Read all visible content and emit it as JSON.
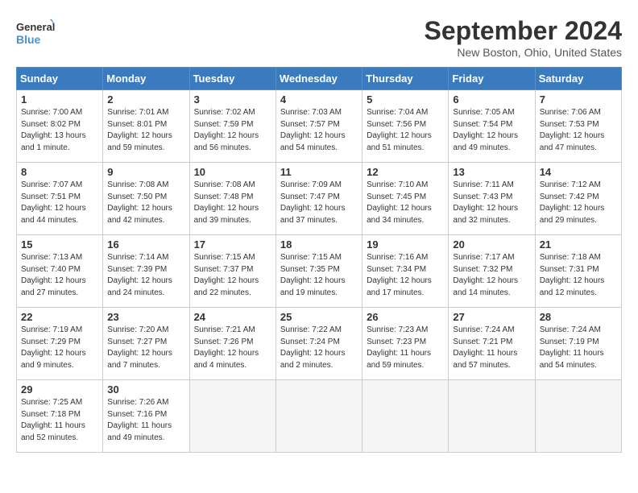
{
  "logo": {
    "line1": "General",
    "line2": "Blue"
  },
  "title": "September 2024",
  "subtitle": "New Boston, Ohio, United States",
  "weekdays": [
    "Sunday",
    "Monday",
    "Tuesday",
    "Wednesday",
    "Thursday",
    "Friday",
    "Saturday"
  ],
  "weeks": [
    [
      {
        "day": "1",
        "info": "Sunrise: 7:00 AM\nSunset: 8:02 PM\nDaylight: 13 hours\nand 1 minute."
      },
      {
        "day": "2",
        "info": "Sunrise: 7:01 AM\nSunset: 8:01 PM\nDaylight: 12 hours\nand 59 minutes."
      },
      {
        "day": "3",
        "info": "Sunrise: 7:02 AM\nSunset: 7:59 PM\nDaylight: 12 hours\nand 56 minutes."
      },
      {
        "day": "4",
        "info": "Sunrise: 7:03 AM\nSunset: 7:57 PM\nDaylight: 12 hours\nand 54 minutes."
      },
      {
        "day": "5",
        "info": "Sunrise: 7:04 AM\nSunset: 7:56 PM\nDaylight: 12 hours\nand 51 minutes."
      },
      {
        "day": "6",
        "info": "Sunrise: 7:05 AM\nSunset: 7:54 PM\nDaylight: 12 hours\nand 49 minutes."
      },
      {
        "day": "7",
        "info": "Sunrise: 7:06 AM\nSunset: 7:53 PM\nDaylight: 12 hours\nand 47 minutes."
      }
    ],
    [
      {
        "day": "8",
        "info": "Sunrise: 7:07 AM\nSunset: 7:51 PM\nDaylight: 12 hours\nand 44 minutes."
      },
      {
        "day": "9",
        "info": "Sunrise: 7:08 AM\nSunset: 7:50 PM\nDaylight: 12 hours\nand 42 minutes."
      },
      {
        "day": "10",
        "info": "Sunrise: 7:08 AM\nSunset: 7:48 PM\nDaylight: 12 hours\nand 39 minutes."
      },
      {
        "day": "11",
        "info": "Sunrise: 7:09 AM\nSunset: 7:47 PM\nDaylight: 12 hours\nand 37 minutes."
      },
      {
        "day": "12",
        "info": "Sunrise: 7:10 AM\nSunset: 7:45 PM\nDaylight: 12 hours\nand 34 minutes."
      },
      {
        "day": "13",
        "info": "Sunrise: 7:11 AM\nSunset: 7:43 PM\nDaylight: 12 hours\nand 32 minutes."
      },
      {
        "day": "14",
        "info": "Sunrise: 7:12 AM\nSunset: 7:42 PM\nDaylight: 12 hours\nand 29 minutes."
      }
    ],
    [
      {
        "day": "15",
        "info": "Sunrise: 7:13 AM\nSunset: 7:40 PM\nDaylight: 12 hours\nand 27 minutes."
      },
      {
        "day": "16",
        "info": "Sunrise: 7:14 AM\nSunset: 7:39 PM\nDaylight: 12 hours\nand 24 minutes."
      },
      {
        "day": "17",
        "info": "Sunrise: 7:15 AM\nSunset: 7:37 PM\nDaylight: 12 hours\nand 22 minutes."
      },
      {
        "day": "18",
        "info": "Sunrise: 7:15 AM\nSunset: 7:35 PM\nDaylight: 12 hours\nand 19 minutes."
      },
      {
        "day": "19",
        "info": "Sunrise: 7:16 AM\nSunset: 7:34 PM\nDaylight: 12 hours\nand 17 minutes."
      },
      {
        "day": "20",
        "info": "Sunrise: 7:17 AM\nSunset: 7:32 PM\nDaylight: 12 hours\nand 14 minutes."
      },
      {
        "day": "21",
        "info": "Sunrise: 7:18 AM\nSunset: 7:31 PM\nDaylight: 12 hours\nand 12 minutes."
      }
    ],
    [
      {
        "day": "22",
        "info": "Sunrise: 7:19 AM\nSunset: 7:29 PM\nDaylight: 12 hours\nand 9 minutes."
      },
      {
        "day": "23",
        "info": "Sunrise: 7:20 AM\nSunset: 7:27 PM\nDaylight: 12 hours\nand 7 minutes."
      },
      {
        "day": "24",
        "info": "Sunrise: 7:21 AM\nSunset: 7:26 PM\nDaylight: 12 hours\nand 4 minutes."
      },
      {
        "day": "25",
        "info": "Sunrise: 7:22 AM\nSunset: 7:24 PM\nDaylight: 12 hours\nand 2 minutes."
      },
      {
        "day": "26",
        "info": "Sunrise: 7:23 AM\nSunset: 7:23 PM\nDaylight: 11 hours\nand 59 minutes."
      },
      {
        "day": "27",
        "info": "Sunrise: 7:24 AM\nSunset: 7:21 PM\nDaylight: 11 hours\nand 57 minutes."
      },
      {
        "day": "28",
        "info": "Sunrise: 7:24 AM\nSunset: 7:19 PM\nDaylight: 11 hours\nand 54 minutes."
      }
    ],
    [
      {
        "day": "29",
        "info": "Sunrise: 7:25 AM\nSunset: 7:18 PM\nDaylight: 11 hours\nand 52 minutes."
      },
      {
        "day": "30",
        "info": "Sunrise: 7:26 AM\nSunset: 7:16 PM\nDaylight: 11 hours\nand 49 minutes."
      },
      {
        "day": "",
        "info": ""
      },
      {
        "day": "",
        "info": ""
      },
      {
        "day": "",
        "info": ""
      },
      {
        "day": "",
        "info": ""
      },
      {
        "day": "",
        "info": ""
      }
    ]
  ]
}
